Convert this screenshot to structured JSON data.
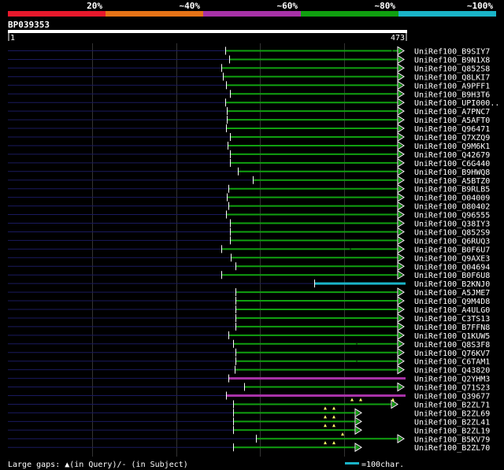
{
  "chart_data": {
    "type": "alignment-overview",
    "query_id": "BP039353",
    "query_length": 473,
    "ruler_start": "1",
    "ruler_end": "473",
    "identity_scale": [
      {
        "label": "20%",
        "color": "#e8192c"
      },
      {
        "label": "~40%",
        "color": "#e67317"
      },
      {
        "label": "~60%",
        "color": "#a832a8"
      },
      {
        "label": "~80%",
        "color": "#10a010"
      },
      {
        "label": "~100%",
        "color": "#1ab4c8"
      }
    ],
    "legend_gaps": "Large gaps: ▲(in Query)/- (in Subject)",
    "legend_scale": "=100char.",
    "hits": [
      {
        "name": "UniRef100_B9SIY7",
        "start": 286,
        "end": 512,
        "color": "#10a010",
        "arrow": true,
        "dot": 497
      },
      {
        "name": "UniRef100_B9N1X8",
        "start": 291,
        "end": 512,
        "color": "#10a010",
        "arrow": true
      },
      {
        "name": "UniRef100_Q852S8",
        "start": 281,
        "end": 512,
        "color": "#10a010",
        "arrow": true
      },
      {
        "name": "UniRef100_Q8LKI7",
        "start": 283,
        "end": 512,
        "color": "#10a010",
        "arrow": true
      },
      {
        "name": "UniRef100_A9PFF1",
        "start": 287,
        "end": 512,
        "color": "#10a010",
        "arrow": true
      },
      {
        "name": "UniRef100_B9H3T6",
        "start": 292,
        "end": 512,
        "color": "#10a010",
        "arrow": true
      },
      {
        "name": "UniRef100_UPI000..",
        "start": 286,
        "end": 512,
        "color": "#10a010",
        "arrow": true
      },
      {
        "name": "UniRef100_A7PNC7",
        "start": 288,
        "end": 512,
        "color": "#10a010",
        "arrow": true
      },
      {
        "name": "UniRef100_A5AFT0",
        "start": 288,
        "end": 512,
        "color": "#10a010",
        "arrow": true
      },
      {
        "name": "UniRef100_Q96471",
        "start": 287,
        "end": 512,
        "color": "#10a010",
        "arrow": true
      },
      {
        "name": "UniRef100_Q7XZQ9",
        "start": 292,
        "end": 512,
        "color": "#10a010",
        "arrow": true
      },
      {
        "name": "UniRef100_Q9M6K1",
        "start": 289,
        "end": 512,
        "color": "#10a010",
        "arrow": true
      },
      {
        "name": "UniRef100_Q42679",
        "start": 292,
        "end": 512,
        "color": "#10a010",
        "arrow": true
      },
      {
        "name": "UniRef100_C6G440",
        "start": 292,
        "end": 512,
        "color": "#10a010",
        "arrow": true
      },
      {
        "name": "UniRef100_B9HWQ8",
        "start": 302,
        "end": 512,
        "color": "#10a010",
        "arrow": true
      },
      {
        "name": "UniRef100_A5BTZ0",
        "start": 321,
        "end": 512,
        "color": "#10a010",
        "arrow": true
      },
      {
        "name": "UniRef100_B9RLB5",
        "start": 290,
        "end": 512,
        "color": "#10a010",
        "arrow": true
      },
      {
        "name": "UniRef100_O04009",
        "start": 288,
        "end": 512,
        "color": "#10a010",
        "arrow": true
      },
      {
        "name": "UniRef100_O80402",
        "start": 290,
        "end": 512,
        "color": "#10a010",
        "arrow": true
      },
      {
        "name": "UniRef100_Q96555",
        "start": 287,
        "end": 512,
        "color": "#10a010",
        "arrow": true
      },
      {
        "name": "UniRef100_Q38IY3",
        "start": 292,
        "end": 512,
        "color": "#10a010",
        "arrow": true
      },
      {
        "name": "UniRef100_Q852S9",
        "start": 292,
        "end": 512,
        "color": "#10a010",
        "arrow": true
      },
      {
        "name": "UniRef100_Q6RUQ3",
        "start": 292,
        "end": 512,
        "color": "#10a010",
        "arrow": true
      },
      {
        "name": "UniRef100_B0F6U7",
        "start": 281,
        "end": 512,
        "color": "#10a010",
        "arrow": true,
        "dot": 444
      },
      {
        "name": "UniRef100_Q9AXE3",
        "start": 293,
        "end": 512,
        "color": "#10a010",
        "arrow": true
      },
      {
        "name": "UniRef100_Q04694",
        "start": 299,
        "end": 512,
        "color": "#10a010",
        "arrow": true
      },
      {
        "name": "UniRef100_B0F6U8",
        "start": 281,
        "end": 512,
        "color": "#10a010",
        "arrow": true
      },
      {
        "name": "UniRef100_B2KNJ0",
        "start": 399,
        "end": 512,
        "color": "#1ab4c8",
        "arrow": false
      },
      {
        "name": "UniRef100_A5JME7",
        "start": 299,
        "end": 512,
        "color": "#10a010",
        "arrow": true
      },
      {
        "name": "UniRef100_Q9M4D8",
        "start": 299,
        "end": 512,
        "color": "#10a010",
        "arrow": true
      },
      {
        "name": "UniRef100_A4ULG0",
        "start": 299,
        "end": 512,
        "color": "#10a010",
        "arrow": true
      },
      {
        "name": "UniRef100_C3TS13",
        "start": 299,
        "end": 512,
        "color": "#10a010",
        "arrow": true
      },
      {
        "name": "UniRef100_B7FFN8",
        "start": 299,
        "end": 512,
        "color": "#10a010",
        "arrow": true
      },
      {
        "name": "UniRef100_Q1KUW5",
        "start": 290,
        "end": 512,
        "color": "#10a010",
        "arrow": true
      },
      {
        "name": "UniRef100_Q8S3F8",
        "start": 296,
        "end": 512,
        "color": "#10a010",
        "arrow": true,
        "dot": 452
      },
      {
        "name": "UniRef100_Q76KV7",
        "start": 299,
        "end": 512,
        "color": "#10a010",
        "arrow": true
      },
      {
        "name": "UniRef100_C6TAM1",
        "start": 299,
        "end": 512,
        "color": "#10a010",
        "arrow": true,
        "dot": 452
      },
      {
        "name": "UniRef100_Q43820",
        "start": 298,
        "end": 512,
        "color": "#10a010",
        "arrow": true
      },
      {
        "name": "UniRef100_Q2YHM3",
        "start": 290,
        "end": 512,
        "color": "#a832a8",
        "arrow": false
      },
      {
        "name": "UniRef100_Q71S23",
        "start": 310,
        "end": 512,
        "color": "#10a010",
        "arrow": true
      },
      {
        "name": "UniRef100_Q39677",
        "start": 287,
        "end": 512,
        "color": "#a832a8",
        "arrow": false
      },
      {
        "name": "UniRef100_B2ZL71",
        "start": 296,
        "end": 504,
        "color": "#10a010",
        "arrow": true,
        "gaps": [
          447,
          458,
          499
        ]
      },
      {
        "name": "UniRef100_B2ZL69",
        "start": 296,
        "end": 458,
        "color": "#10a010",
        "arrow": true,
        "gaps": [
          413,
          424
        ]
      },
      {
        "name": "UniRef100_B2ZL41",
        "start": 296,
        "end": 458,
        "color": "#10a010",
        "arrow": true,
        "gaps": [
          413,
          424
        ]
      },
      {
        "name": "UniRef100_B2ZL19",
        "start": 296,
        "end": 458,
        "color": "#10a010",
        "arrow": true,
        "gaps": [
          413,
          424
        ]
      },
      {
        "name": "UniRef100_B5KV79",
        "start": 325,
        "end": 512,
        "color": "#10a010",
        "arrow": true,
        "gaps": [
          435
        ]
      },
      {
        "name": "UniRef100_B2ZL70",
        "start": 296,
        "end": 458,
        "color": "#10a010",
        "arrow": true,
        "gaps": [
          413,
          424
        ]
      }
    ]
  }
}
